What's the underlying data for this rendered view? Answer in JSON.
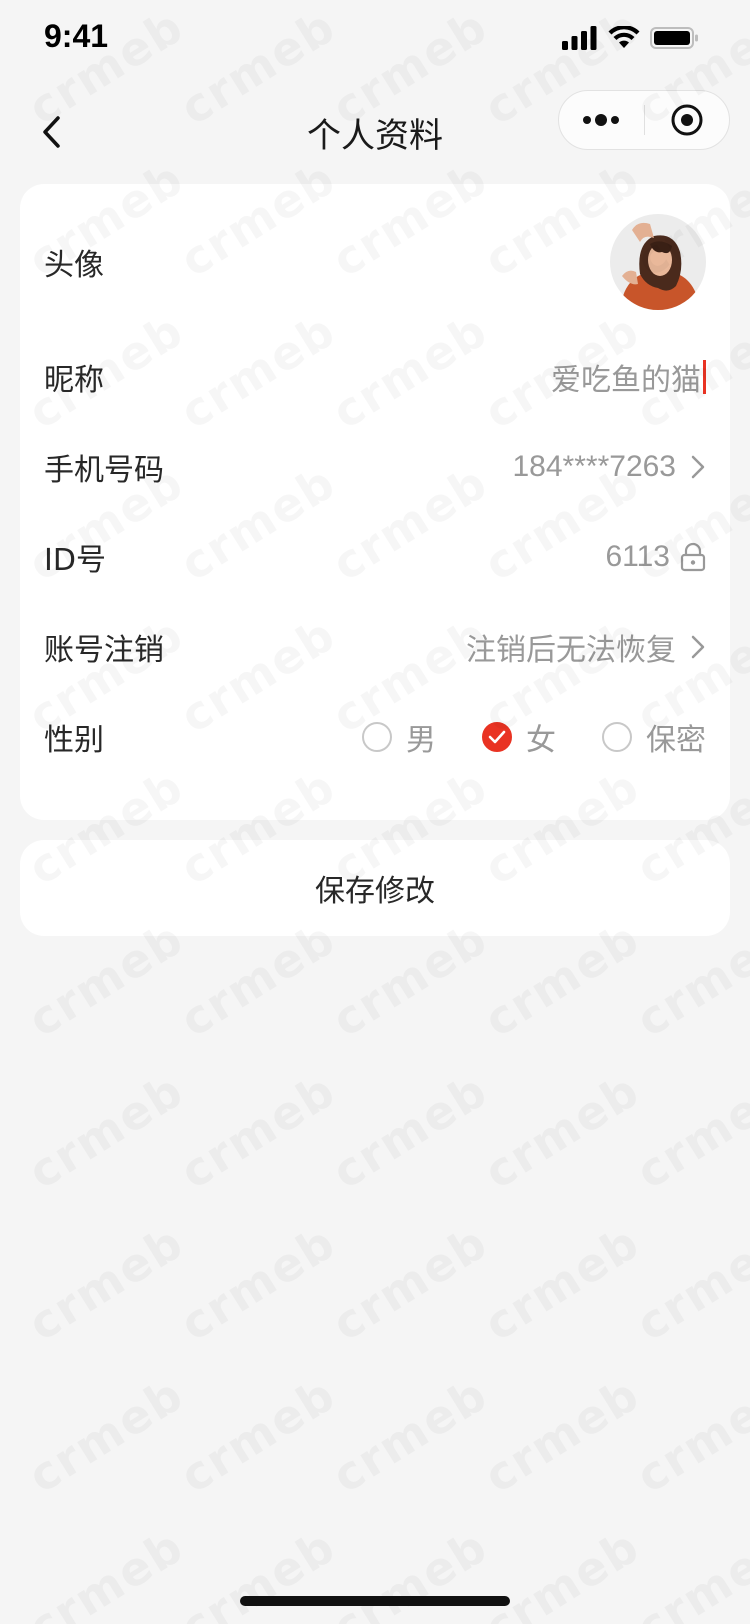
{
  "status_bar": {
    "time": "9:41"
  },
  "nav": {
    "title": "个人资料",
    "back_icon": "chevron-left-icon",
    "more_icon": "more-dots-icon",
    "close_icon": "target-circle-icon"
  },
  "profile": {
    "avatar_label": "头像",
    "nickname_label": "昵称",
    "nickname_value": "爱吃鱼的猫",
    "phone_label": "手机号码",
    "phone_value": "184****7263",
    "id_label": "ID号",
    "id_value": "6113",
    "account_cancel_label": "账号注销",
    "account_cancel_value": "注销后无法恢复",
    "gender_label": "性别",
    "gender_options": [
      {
        "label": "男",
        "checked": false
      },
      {
        "label": "女",
        "checked": true
      },
      {
        "label": "保密",
        "checked": false
      }
    ]
  },
  "actions": {
    "save_label": "保存修改"
  },
  "watermark": {
    "text": "crmeb"
  },
  "colors": {
    "accent": "#e93323",
    "background": "#f5f5f5",
    "card": "#ffffff",
    "secondary_text": "#999999"
  }
}
